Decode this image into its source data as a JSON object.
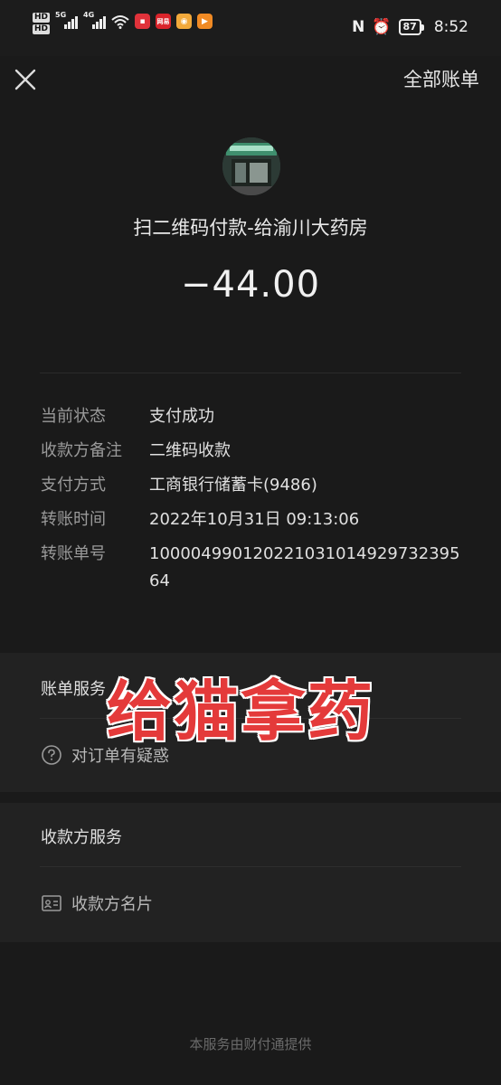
{
  "status_bar": {
    "network_labels": [
      "HD",
      "HD"
    ],
    "signal1_label": "5G",
    "signal2_label": "4G",
    "battery": "87",
    "time": "8:52",
    "app_icon_label": "网易"
  },
  "header": {
    "all_bills": "全部账单"
  },
  "payment": {
    "merchant": "扫二维码付款-给渝川大药房",
    "amount": "−44.00"
  },
  "details": [
    {
      "label": "当前状态",
      "value": "支付成功"
    },
    {
      "label": "收款方备注",
      "value": "二维码收款"
    },
    {
      "label": "支付方式",
      "value": "工商银行储蓄卡(9486)"
    },
    {
      "label": "转账时间",
      "value": "2022年10月31日 09:13:06"
    },
    {
      "label": "转账单号",
      "value": "100004990120221031014929732395 64"
    }
  ],
  "bill_service": {
    "title": "账单服务",
    "item": "对订单有疑惑"
  },
  "payee_service": {
    "title": "收款方服务",
    "item": "收款方名片"
  },
  "watermark": "给猫拿药",
  "footer": "本服务由财付通提供"
}
